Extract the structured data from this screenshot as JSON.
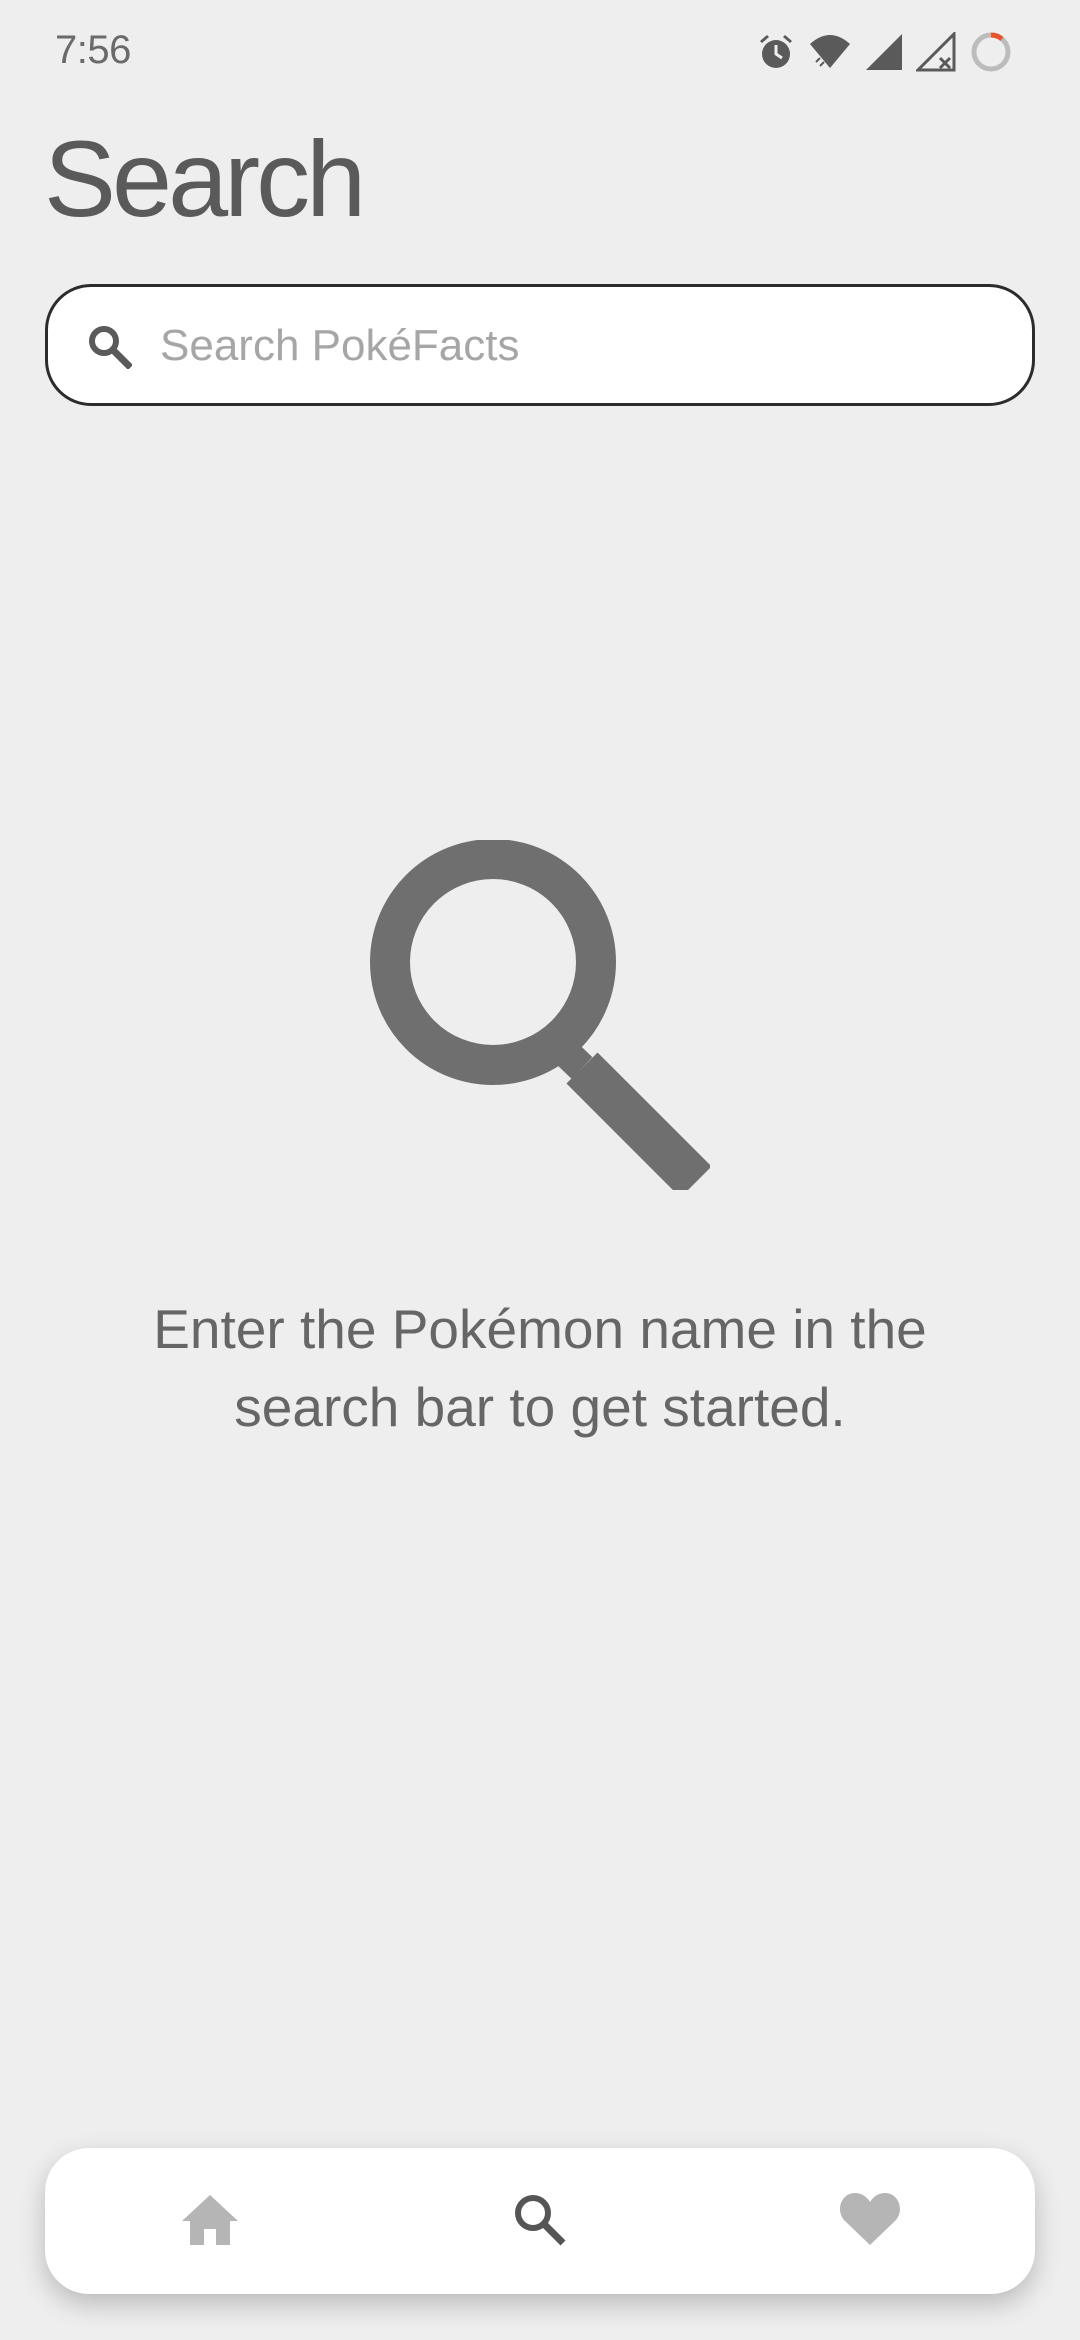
{
  "status_bar": {
    "time": "7:56",
    "icons": [
      "alarm-icon",
      "wifi-icon",
      "signal-icon",
      "signal-no-service-icon",
      "battery-saver-ring-icon"
    ]
  },
  "header": {
    "title": "Search"
  },
  "search": {
    "placeholder": "Search PokéFacts",
    "value": "",
    "icon": "search-icon"
  },
  "empty_state": {
    "icon": "magnifier-icon",
    "message": "Enter the Pokémon name in the search bar to get started."
  },
  "bottom_nav": {
    "items": [
      {
        "name": "home",
        "icon": "home-icon",
        "active": false
      },
      {
        "name": "search",
        "icon": "search-icon",
        "active": true
      },
      {
        "name": "favorites",
        "icon": "heart-icon",
        "active": false
      }
    ]
  },
  "colors": {
    "background": "#eeeeee",
    "title": "#5a5a5a",
    "icon_active": "#555555",
    "icon_inactive": "#b5b5b5",
    "empty_icon": "#6f6f6f",
    "status_accent": "#e8542c"
  }
}
